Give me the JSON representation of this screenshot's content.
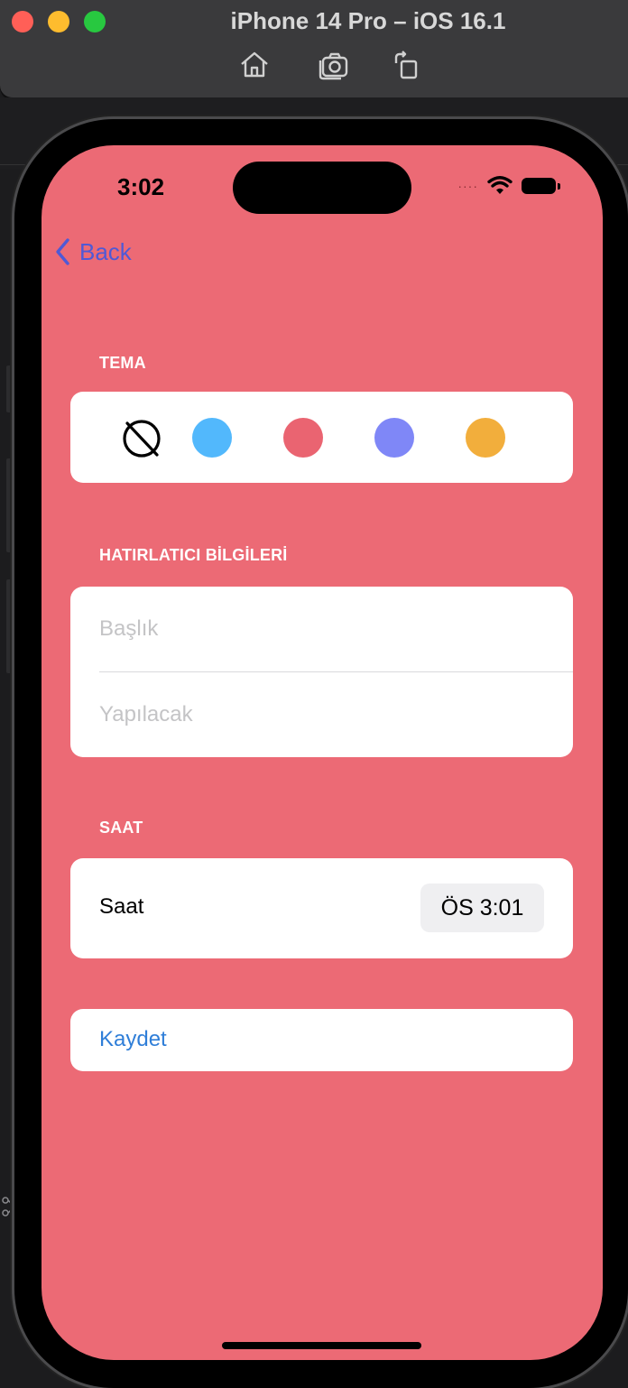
{
  "simulator": {
    "title": "iPhone 14 Pro – iOS 16.1",
    "toolbar": [
      "home-icon",
      "screenshot-icon",
      "rotate-icon"
    ]
  },
  "status_bar": {
    "time": "3:02",
    "signal": "····"
  },
  "nav": {
    "back_label": "Back"
  },
  "sections": {
    "theme_header": "TEMA",
    "info_header": "HATIRLATICI BİLGİLERİ",
    "time_header": "SAAT"
  },
  "theme": {
    "none_icon": "no-color-icon",
    "swatches": [
      {
        "name": "blue",
        "color": "#52b8fc"
      },
      {
        "name": "red",
        "color": "#ea6471"
      },
      {
        "name": "purple",
        "color": "#7f87f7"
      },
      {
        "name": "orange",
        "color": "#f2ae3c"
      }
    ]
  },
  "form": {
    "title_placeholder": "Başlık",
    "todo_placeholder": "Yapılacak"
  },
  "time": {
    "label": "Saat",
    "value": "ÖS 3:01"
  },
  "save": {
    "label": "Kaydet"
  },
  "colors": {
    "screen_background": "#ec6a75",
    "accent": "#2f7ed8",
    "back_tint": "#4f59d6"
  }
}
